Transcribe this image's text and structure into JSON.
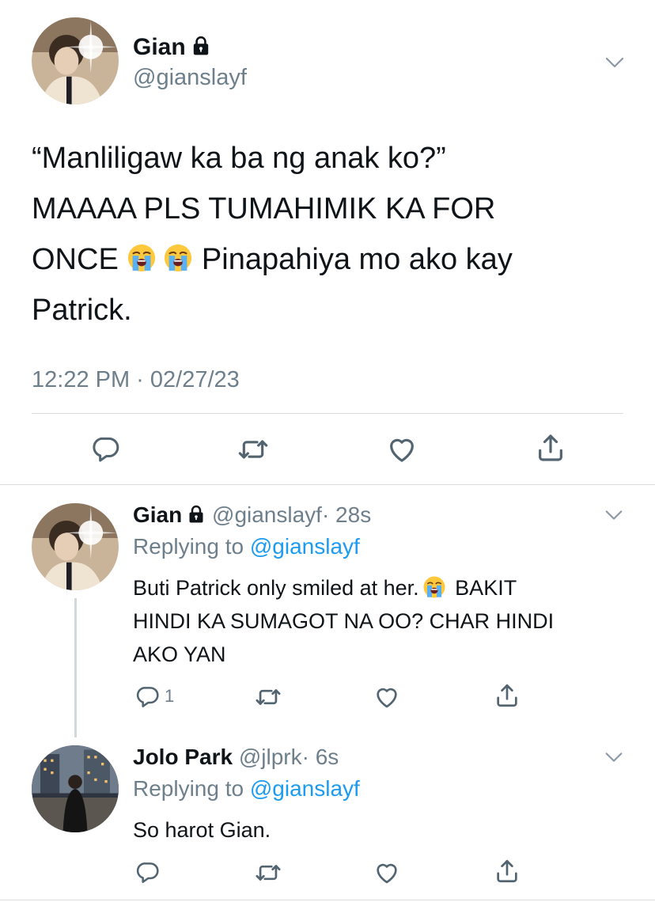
{
  "main_tweet": {
    "display_name": "Gian",
    "handle": "@gianslayf",
    "text_lines": [
      "“Manliligaw ka ba ng anak ko?”",
      "MAAAA PLS TUMAHIMIK KA FOR",
      "ONCE",
      "Pinapahiya mo ako kay",
      "Patrick."
    ],
    "timestamp": "12:22 PM · 02/27/23",
    "icons": [
      "reply-icon",
      "retweet-icon",
      "like-icon",
      "share-icon"
    ]
  },
  "replies": [
    {
      "display_name": "Gian",
      "handle": "@gianslayf",
      "time": "· 28s",
      "replying_prefix": "Replying to",
      "replying_to": "@gianslayf",
      "text_lines": [
        "Buti Patrick only smiled at her.",
        "BAKIT",
        "HINDI KA SUMAGOT NA OO? CHAR HINDI",
        "AKO YAN"
      ],
      "reply_count": "1"
    },
    {
      "display_name": "Jolo Park",
      "handle": "@jlprk",
      "time": "· 6s",
      "replying_prefix": "Replying to",
      "replying_to": "@gianslayf",
      "text_lines": [
        "So harot Gian."
      ],
      "reply_count": ""
    }
  ],
  "colors": {
    "text": "#0f1419",
    "muted": "#6e7f8c",
    "link": "#1d9bf0",
    "divider": "#d9dde1"
  }
}
